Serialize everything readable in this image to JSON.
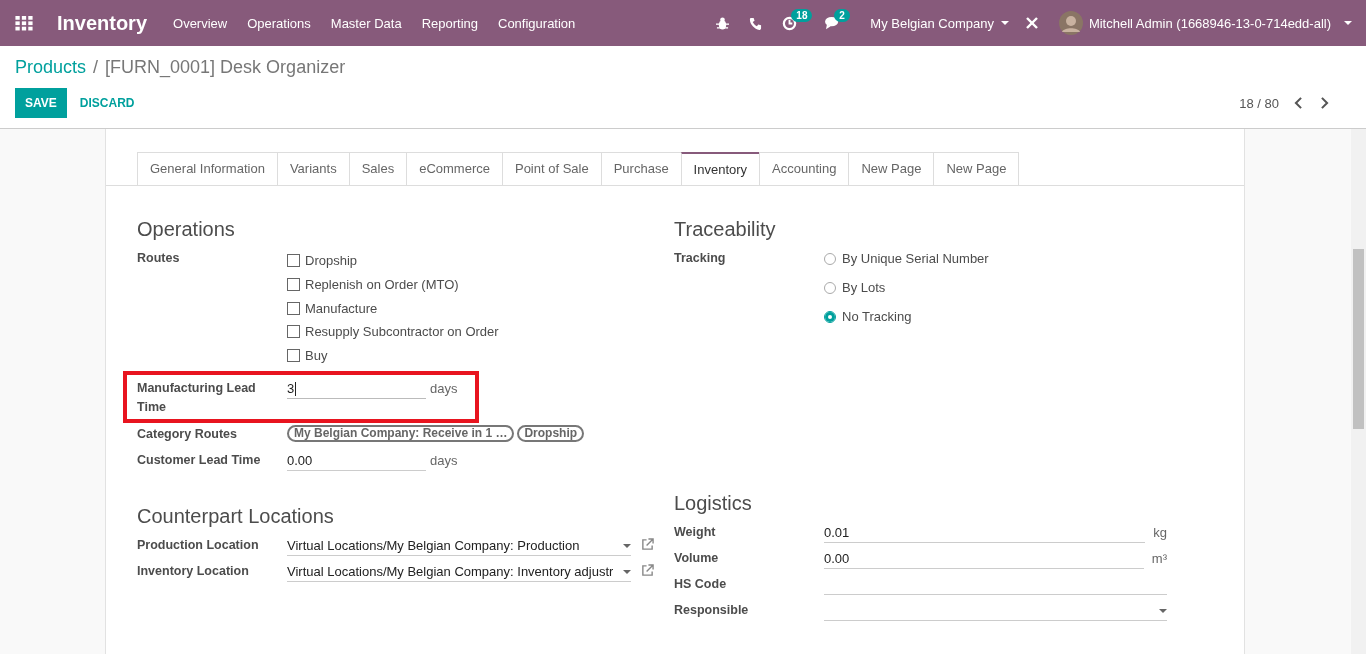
{
  "navbar": {
    "app_title": "Inventory",
    "menu": [
      "Overview",
      "Operations",
      "Master Data",
      "Reporting",
      "Configuration"
    ],
    "activity_count": "18",
    "message_count": "2",
    "company": "My Belgian Company",
    "user": "Mitchell Admin (1668946-13-0-714edd-all)"
  },
  "breadcrumb": {
    "parent": "Products",
    "separator": "/",
    "current": "[FURN_0001] Desk Organizer"
  },
  "buttons": {
    "save": "SAVE",
    "discard": "DISCARD"
  },
  "pager": {
    "value": "18 / 80"
  },
  "tabs": [
    {
      "label": "General Information",
      "selected": false
    },
    {
      "label": "Variants",
      "selected": false
    },
    {
      "label": "Sales",
      "selected": false
    },
    {
      "label": "eCommerce",
      "selected": false
    },
    {
      "label": "Point of Sale",
      "selected": false
    },
    {
      "label": "Purchase",
      "selected": false
    },
    {
      "label": "Inventory",
      "selected": true
    },
    {
      "label": "Accounting",
      "selected": false
    },
    {
      "label": "New Page",
      "selected": false
    },
    {
      "label": "New Page",
      "selected": false
    }
  ],
  "operations": {
    "title": "Operations",
    "routes_label": "Routes",
    "routes": [
      {
        "label": "Dropship",
        "checked": false
      },
      {
        "label": "Replenish on Order (MTO)",
        "checked": false
      },
      {
        "label": "Manufacture",
        "checked": false
      },
      {
        "label": "Resupply Subcontractor on Order",
        "checked": false
      },
      {
        "label": "Buy",
        "checked": false
      }
    ],
    "fields": [
      {
        "kind": "number",
        "label": "Manufacturing Lead Time",
        "value": "3",
        "unit": "days",
        "highlighted": true,
        "focused": true
      },
      {
        "kind": "tags",
        "label": "Category Routes",
        "tags": [
          "My Belgian Company: Receive in 1 …",
          "Dropship"
        ]
      },
      {
        "kind": "number",
        "label": "Customer Lead Time",
        "value": "0.00",
        "unit": "days",
        "highlighted": false,
        "focused": false
      }
    ]
  },
  "traceability": {
    "title": "Traceability",
    "label": "Tracking",
    "options": [
      {
        "label": "By Unique Serial Number",
        "selected": false
      },
      {
        "label": "By Lots",
        "selected": false
      },
      {
        "label": "No Tracking",
        "selected": true
      }
    ]
  },
  "counterpart_locations": {
    "title": "Counterpart Locations",
    "fields": [
      {
        "label": "Production Location",
        "value": "Virtual Locations/My Belgian Company: Production"
      },
      {
        "label": "Inventory Location",
        "value": "Virtual Locations/My Belgian Company: Inventory adjustr"
      }
    ]
  },
  "logistics": {
    "title": "Logistics",
    "fields": [
      {
        "kind": "number",
        "label": "Weight",
        "value": "0.01",
        "unit": "kg"
      },
      {
        "kind": "number",
        "label": "Volume",
        "value": "0.00",
        "unit": "m³"
      },
      {
        "kind": "text",
        "label": "HS Code"
      },
      {
        "kind": "select",
        "label": "Responsible"
      }
    ]
  }
}
